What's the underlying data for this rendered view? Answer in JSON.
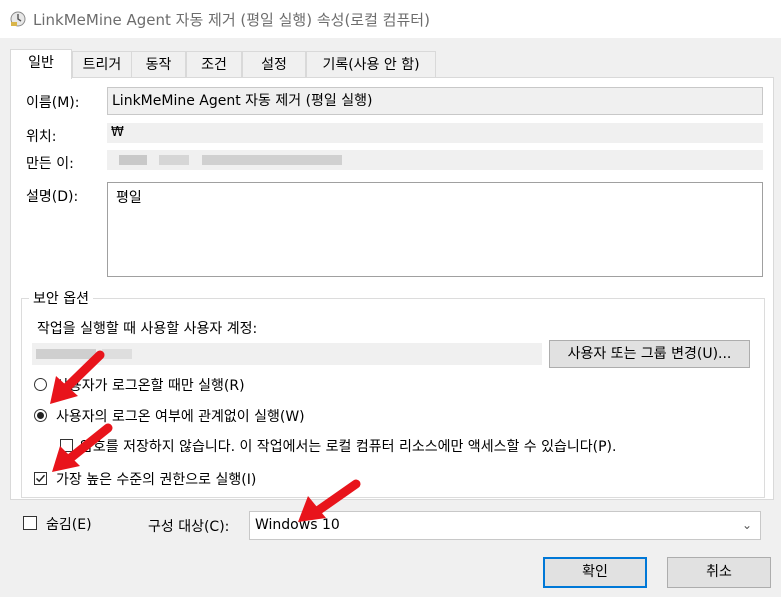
{
  "window": {
    "title": "LinkMeMine Agent 자동 제거 (평일 실행) 속성(로컬 컴퓨터)"
  },
  "tabs": [
    {
      "label": "일반",
      "active": true
    },
    {
      "label": "트리거"
    },
    {
      "label": "동작"
    },
    {
      "label": "조건"
    },
    {
      "label": "설정"
    },
    {
      "label": "기록(사용 안 함)"
    }
  ],
  "general": {
    "name_label": "이름(M):",
    "name_value": "LinkMeMine Agent 자동 제거 (평일 실행)",
    "location_label": "위치:",
    "location_value": "₩",
    "author_label": "만든 이:",
    "description_label": "설명(D):",
    "description_value": "평일"
  },
  "security": {
    "group_title": "보안 옵션",
    "account_prompt": "작업을 실행할 때 사용할 사용자 계정:",
    "change_user_button": "사용자 또는 그룹 변경(U)...",
    "radio_logged_on": "사용자가 로그온할 때만 실행(R)",
    "radio_whether_logged_on": "사용자의 로그온 여부에 관계없이 실행(W)",
    "selected_radio": "radio_whether_logged_on",
    "do_not_store_password": "암호를 저장하지 않습니다. 이 작업에서는 로컬 컴퓨터 리소스에만 액세스할 수 있습니다(P).",
    "do_not_store_password_checked": false,
    "highest_privileges": "가장 높은 수준의 권한으로 실행(I)",
    "highest_privileges_checked": true
  },
  "footer": {
    "hidden_label": "숨김(E)",
    "hidden_checked": false,
    "configure_label": "구성 대상(C):",
    "configure_value": "Windows 10",
    "ok_button": "확인",
    "cancel_button": "취소"
  },
  "colors": {
    "annotation_arrow": "#e8141b",
    "primary_button_border": "#0078d7"
  }
}
